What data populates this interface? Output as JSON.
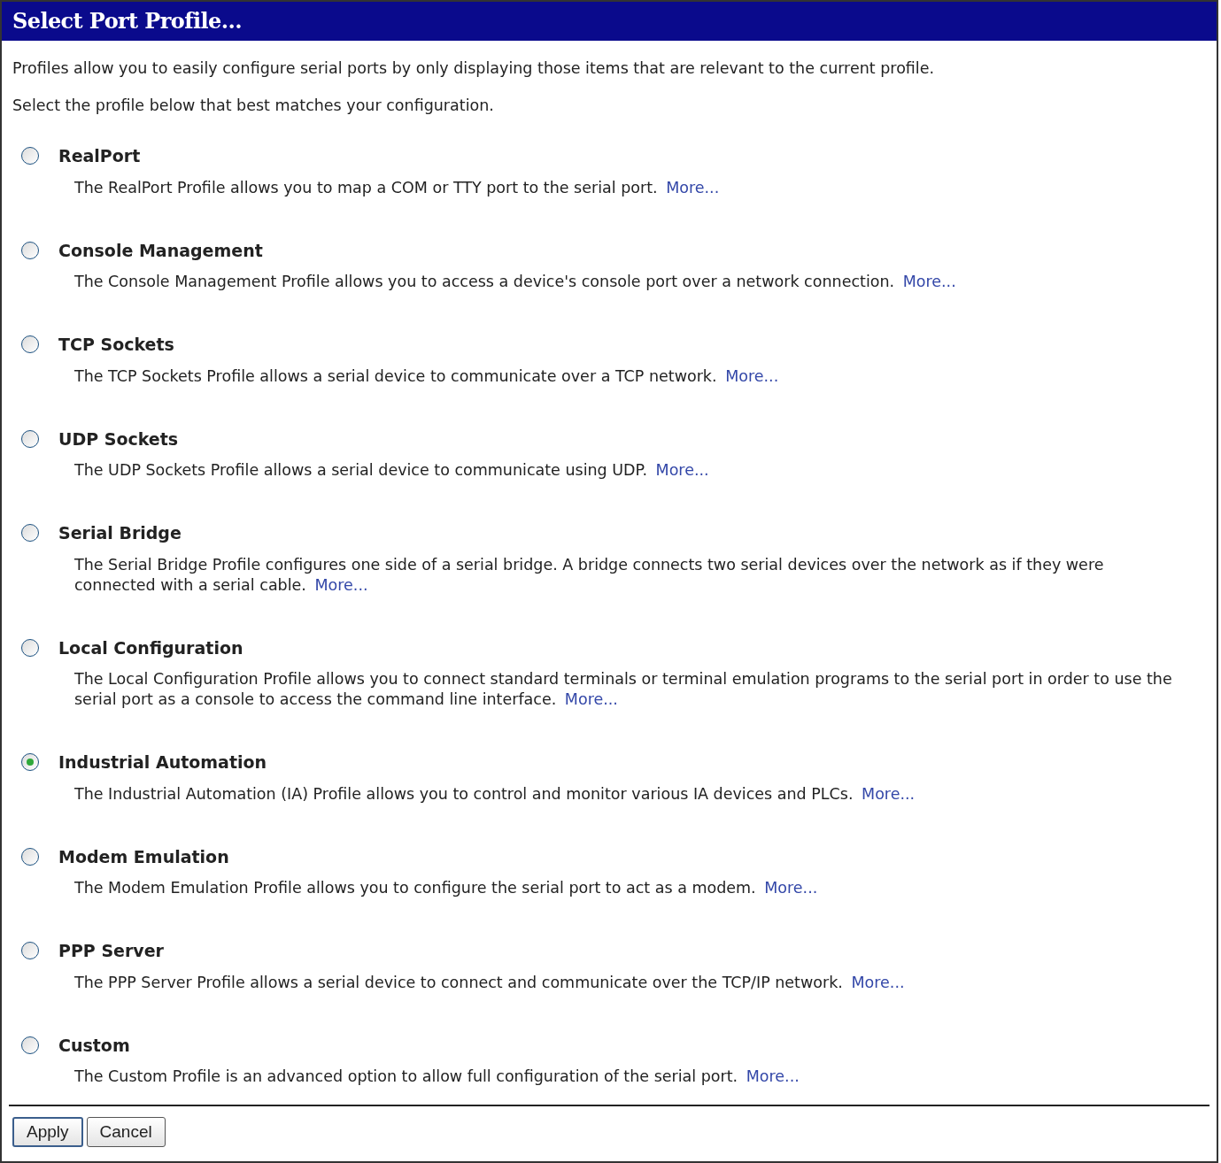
{
  "header": {
    "title": "Select Port Profile..."
  },
  "intro": [
    "Profiles allow you to easily configure serial ports by only displaying those items that are relevant to the current profile.",
    "Select the profile below that best matches your configuration."
  ],
  "profiles": [
    {
      "name": "RealPort",
      "description": "The RealPort Profile allows you to map a COM or TTY port to the serial port.",
      "link": "More...",
      "selected": false
    },
    {
      "name": "Console Management",
      "description": "The Console Management Profile allows you to access a device's console port over a network connection.",
      "link": "More...",
      "selected": false
    },
    {
      "name": "TCP Sockets",
      "description": "The TCP Sockets Profile allows a serial device to communicate over a TCP network.",
      "link": "More...",
      "selected": false
    },
    {
      "name": "UDP Sockets",
      "description": "The UDP Sockets Profile allows a serial device to communicate using UDP.",
      "link": "More...",
      "selected": false
    },
    {
      "name": "Serial Bridge",
      "description": "The Serial Bridge Profile configures one side of a serial bridge. A bridge connects two serial devices over the network as if they were connected with a serial cable.",
      "link": "More...",
      "selected": false
    },
    {
      "name": "Local Configuration",
      "description": "The Local Configuration Profile allows you to connect standard terminals or terminal emulation programs to the serial port in order to use the serial port as a console to access the command line interface.",
      "link": "More...",
      "selected": false
    },
    {
      "name": "Industrial Automation",
      "description": "The Industrial Automation (IA) Profile allows you to control and monitor various IA devices and PLCs.",
      "link": "More...",
      "selected": true
    },
    {
      "name": "Modem Emulation",
      "description": "The Modem Emulation Profile allows you to configure the serial port to act as a modem.",
      "link": "More...",
      "selected": false
    },
    {
      "name": "PPP Server",
      "description": "The PPP Server Profile allows a serial device to connect and communicate over the TCP/IP network.",
      "link": "More...",
      "selected": false
    },
    {
      "name": "Custom",
      "description": "The Custom Profile is an advanced option to allow full configuration of the serial port.",
      "link": "More...",
      "selected": false
    }
  ],
  "buttons": [
    "Apply",
    "Cancel"
  ]
}
